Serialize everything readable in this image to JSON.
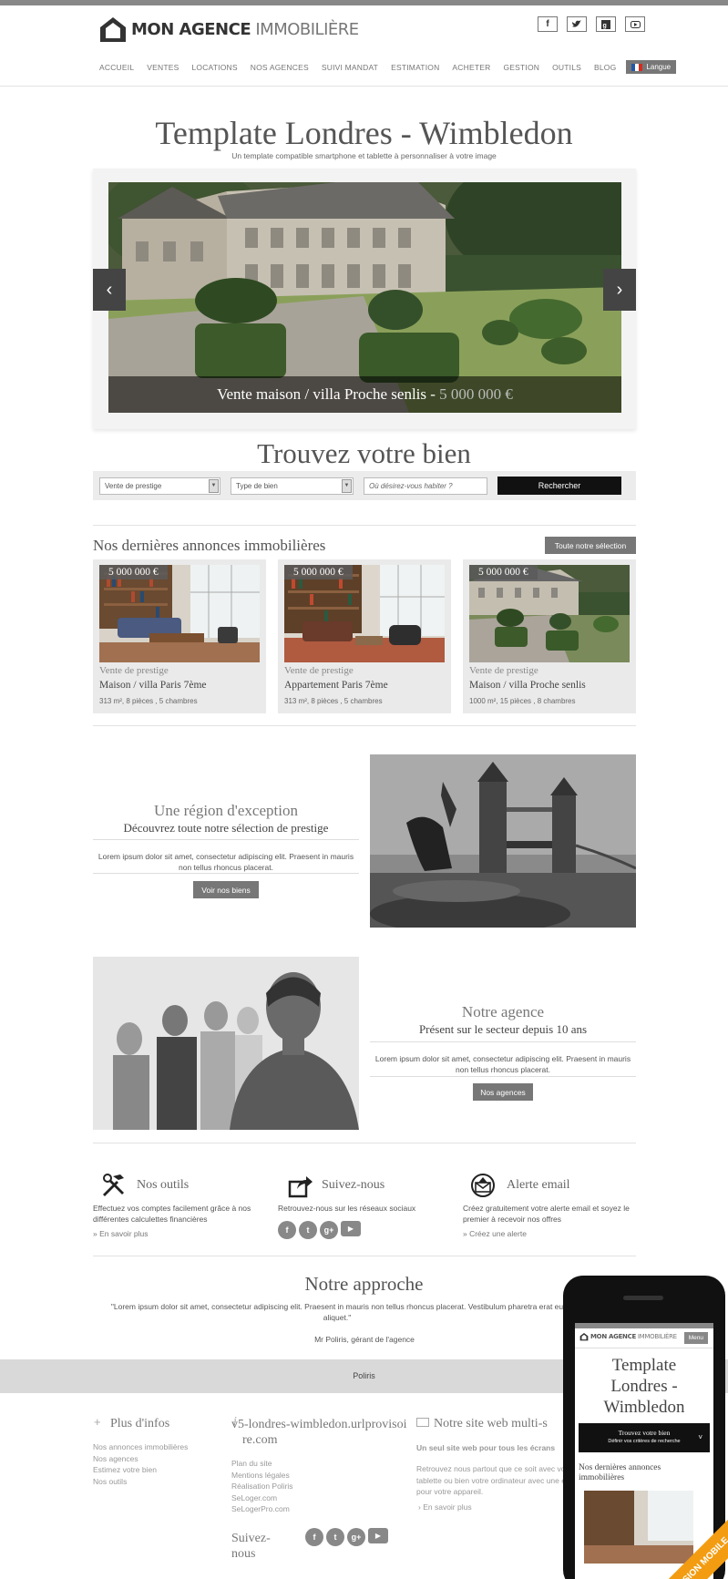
{
  "brand": {
    "name_bold": "MON AGENCE",
    "name_light": "IMMOBILIÈRE"
  },
  "social_top": [
    "f",
    "t",
    "g+",
    "yt"
  ],
  "nav": [
    "ACCUEIL",
    "VENTES",
    "LOCATIONS",
    "NOS AGENCES",
    "SUIVI MANDAT",
    "ESTIMATION",
    "ACHETER",
    "GESTION",
    "OUTILS",
    "BLOG"
  ],
  "lang_label": "Langue",
  "hero": {
    "title": "Template Londres - Wimbledon",
    "subtitle": "Un template compatible smartphone et tablette à personnaliser à votre image"
  },
  "slide": {
    "caption": "Vente maison / villa Proche senlis - ",
    "price": "5 000 000 €"
  },
  "search": {
    "title": "Trouvez votre bien",
    "select1": "Vente de prestige",
    "select2": "Type de bien",
    "placeholder": "Où désirez-vous habiter ?",
    "button": "Rechercher"
  },
  "listings": {
    "title": "Nos dernières annonces immobilières",
    "all_button": "Toute notre sélection",
    "items": [
      {
        "price": "5 000 000 €",
        "category": "Vente de prestige",
        "name": "Maison / villa Paris 7ème",
        "details": "313 m², 8 pièces , 5 chambres"
      },
      {
        "price": "5 000 000 €",
        "category": "Vente de prestige",
        "name": "Appartement Paris 7ème",
        "details": "313 m², 8 pièces , 5 chambres"
      },
      {
        "price": "5 000 000 €",
        "category": "Vente de prestige",
        "name": "Maison / villa Proche senlis",
        "details": "1000 m², 15 pièces , 8 chambres"
      }
    ]
  },
  "region": {
    "title": "Une région d'exception",
    "subtitle": "Découvrez toute notre sélection de prestige",
    "text": "Lorem ipsum dolor sit amet, consectetur adipiscing elit. Praesent in mauris non tellus rhoncus placerat.",
    "button": "Voir nos biens"
  },
  "agency": {
    "title": "Notre agence",
    "subtitle": "Présent sur le secteur depuis 10 ans",
    "text": "Lorem ipsum dolor sit amet, consectetur adipiscing elit. Praesent in mauris non tellus rhoncus placerat.",
    "button": "Nos agences"
  },
  "columns": [
    {
      "title": "Nos outils",
      "text": "Effectuez vos comptes facilement grâce à nos différentes calculettes financières",
      "link": "» En savoir plus"
    },
    {
      "title": "Suivez-nous",
      "text": "Retrouvez-nous sur les réseaux sociaux"
    },
    {
      "title": "Alerte email",
      "text": "Créez gratuitement votre alerte email et soyez le premier à recevoir nos offres",
      "link": "» Créez une alerte"
    }
  ],
  "approach": {
    "title": "Notre approche",
    "quote": "\"Lorem ipsum dolor sit amet, consectetur adipiscing elit. Praesent in mauris non tellus rhoncus placerat. Vestibulum pharetra erat eu aliquet.\"",
    "author": "Mr Poliris, gérant de l'agence"
  },
  "footer_band": "Poliris",
  "footer": {
    "infos_title": "Plus d'infos",
    "infos_links": [
      "Nos annonces immobilières",
      "Nos agences",
      "Estimez votre bien",
      "Nos outils"
    ],
    "site_title": "v5-londres-wimbledon.urlprovisoire.com",
    "site_links": [
      "Plan du site",
      "Mentions légales",
      "Réalisation Poliris",
      "SeLoger.com",
      "SeLogerPro.com"
    ],
    "follow_title": "Suivez-nous",
    "multi_title": "Notre site web multi-s",
    "multi_sub": "Un seul site web pour tous les écrans",
    "multi_text": "Retrouvez nous partout que ce soit avec votre tablette ou bien votre ordinateur avec une enrichie pour votre appareil.",
    "multi_link": "En savoir plus"
  },
  "phone": {
    "menu": "Menu",
    "title": "Template Londres - Wimbledon",
    "search_title": "Trouvez votre bien",
    "search_sub": "Définir vos critères de recherche",
    "section": "Nos dernières annonces immobilières"
  },
  "ribbon": "VERSION MOBILE",
  "colors": {
    "accent_grey": "#777777",
    "ribbon_orange": "#f39c12"
  }
}
